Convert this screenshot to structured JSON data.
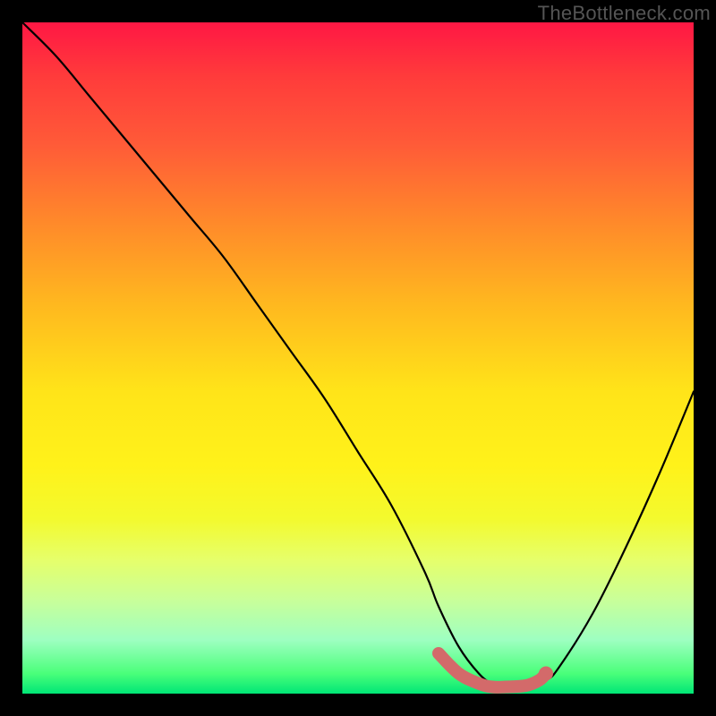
{
  "watermark": "TheBottleneck.com",
  "colors": {
    "frame": "#000000",
    "curve": "#000000",
    "marker_fill": "#d36a6a",
    "marker_stroke": "#d36a6a",
    "gradient_top": "#ff1744",
    "gradient_bottom": "#00e676"
  },
  "chart_data": {
    "type": "line",
    "title": "",
    "xlabel": "",
    "ylabel": "",
    "xlim": [
      0,
      100
    ],
    "ylim": [
      0,
      100
    ],
    "grid": false,
    "series": [
      {
        "name": "bottleneck-curve",
        "x": [
          0,
          5,
          10,
          15,
          20,
          25,
          30,
          35,
          40,
          45,
          50,
          55,
          60,
          62,
          65,
          68,
          70,
          72,
          75,
          78,
          80,
          85,
          90,
          95,
          100
        ],
        "y": [
          100,
          95,
          89,
          83,
          77,
          71,
          65,
          58,
          51,
          44,
          36,
          28,
          18,
          13,
          7,
          3,
          1.5,
          1,
          1.2,
          2,
          4,
          12,
          22,
          33,
          45
        ]
      }
    ],
    "highlight_segment": {
      "name": "optimal-range",
      "x": [
        62,
        65,
        68,
        70,
        72,
        75,
        77,
        78
      ],
      "y": [
        6,
        3,
        1.5,
        1,
        1,
        1.2,
        2,
        3
      ]
    },
    "marker": {
      "x": 78,
      "y": 3
    }
  }
}
